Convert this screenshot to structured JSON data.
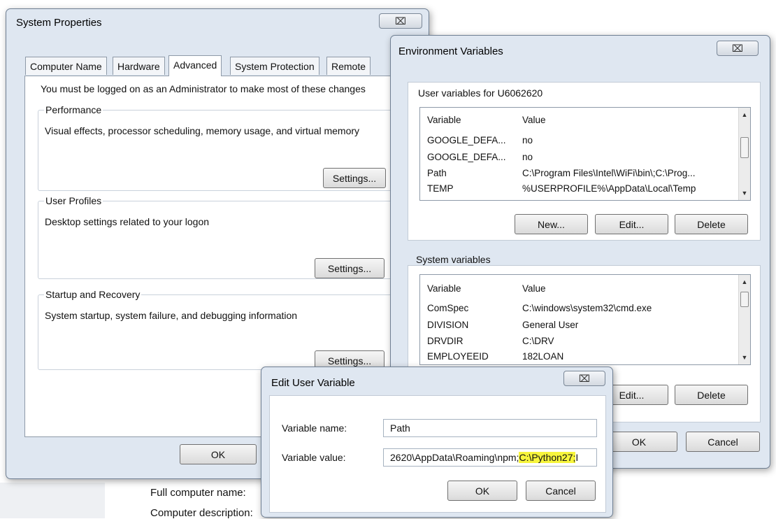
{
  "background": {
    "full_computer_name": "Full computer name:",
    "computer_description": "Computer description:"
  },
  "system_properties": {
    "title": "System Properties",
    "close": "⌧",
    "tabs": [
      "Computer Name",
      "Hardware",
      "Advanced",
      "System Protection",
      "Remote"
    ],
    "active_tab": "Advanced",
    "admin_note": "You must be logged on as an Administrator to make most of these changes",
    "performance": {
      "label": "Performance",
      "desc": "Visual effects, processor scheduling, memory usage, and virtual memory",
      "button": "Settings..."
    },
    "user_profiles": {
      "label": "User Profiles",
      "desc": "Desktop settings related to your logon",
      "button": "Settings..."
    },
    "startup_recovery": {
      "label": "Startup and Recovery",
      "desc": "System startup, system failure, and debugging information",
      "button": "Settings..."
    },
    "ok": "OK"
  },
  "env_vars": {
    "title": "Environment Variables",
    "close": "⌧",
    "user_label": "User variables for U6062620",
    "col_variable": "Variable",
    "col_value": "Value",
    "user_rows": [
      {
        "variable": "GOOGLE_DEFA...",
        "value": "no"
      },
      {
        "variable": "GOOGLE_DEFA...",
        "value": "no"
      },
      {
        "variable": "Path",
        "value": "C:\\Program Files\\Intel\\WiFi\\bin\\;C:\\Prog..."
      },
      {
        "variable": "TEMP",
        "value": "%USERPROFILE%\\AppData\\Local\\Temp"
      }
    ],
    "user_buttons": {
      "new": "New...",
      "edit": "Edit...",
      "delete": "Delete"
    },
    "system_label": "System variables",
    "system_rows": [
      {
        "variable": "ComSpec",
        "value": "C:\\windows\\system32\\cmd.exe"
      },
      {
        "variable": "DIVISION",
        "value": "General User"
      },
      {
        "variable": "DRVDIR",
        "value": "C:\\DRV"
      },
      {
        "variable": "EMPLOYEEID",
        "value": "182LOAN"
      }
    ],
    "system_buttons": {
      "edit": "Edit...",
      "delete": "Delete"
    },
    "ok": "OK",
    "cancel": "Cancel"
  },
  "edit_user_var": {
    "title": "Edit User Variable",
    "close": "⌧",
    "name_label": "Variable name:",
    "name_value": "Path",
    "value_label": "Variable value:",
    "value_prefix": "2620\\AppData\\Roaming\\npm;",
    "value_highlight": "C:\\Python27;",
    "value_suffix": "I",
    "highlight_color": "#f7f53c",
    "ok": "OK",
    "cancel": "Cancel"
  }
}
